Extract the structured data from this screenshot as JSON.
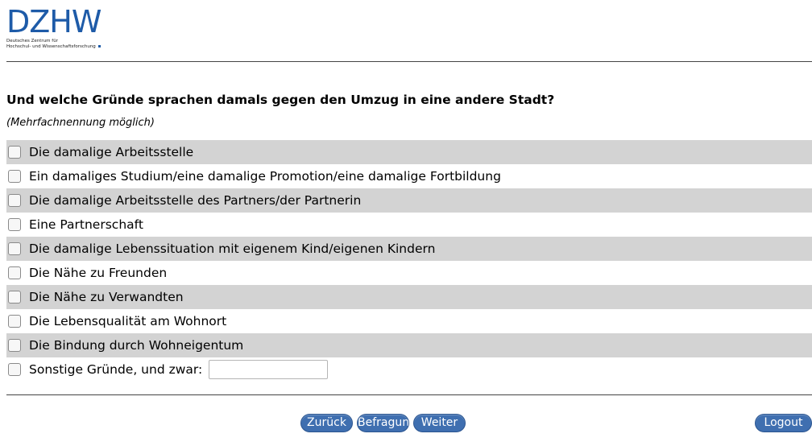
{
  "logo": {
    "mark": "DZHW",
    "subtitle_line1": "Deutsches Zentrum für",
    "subtitle_line2": "Hochschul- und Wissenschaftsforschung",
    "color": "#1e5ba8"
  },
  "question": {
    "title": "Und welche Gründe sprachen damals gegen den Umzug in eine andere Stadt?",
    "hint": "(Mehrfachnennung möglich)"
  },
  "options": [
    {
      "label": "Die damalige Arbeitsstelle",
      "checked": false
    },
    {
      "label": "Ein damaliges Studium/eine damalige Promotion/eine damalige Fortbildung",
      "checked": false
    },
    {
      "label": "Die damalige Arbeitsstelle des Partners/der Partnerin",
      "checked": false
    },
    {
      "label": "Eine Partnerschaft",
      "checked": false
    },
    {
      "label": "Die damalige Lebenssituation mit eigenem Kind/eigenen Kindern",
      "checked": false
    },
    {
      "label": "Die Nähe zu Freunden",
      "checked": false
    },
    {
      "label": "Die Nähe zu Verwandten",
      "checked": false
    },
    {
      "label": "Die Lebensqualität am Wohnort",
      "checked": false
    },
    {
      "label": "Die Bindung durch Wohneigentum",
      "checked": false
    },
    {
      "label": "Sonstige Gründe, und zwar:",
      "checked": false
    }
  ],
  "other_input": {
    "value": "",
    "placeholder": ""
  },
  "buttons": {
    "back": "Zurück",
    "survey": "Befragung",
    "next": "Weiter",
    "logout": "Logout"
  },
  "colors": {
    "row_shaded": "#d3d3d3",
    "button": "#3f6fb0"
  }
}
